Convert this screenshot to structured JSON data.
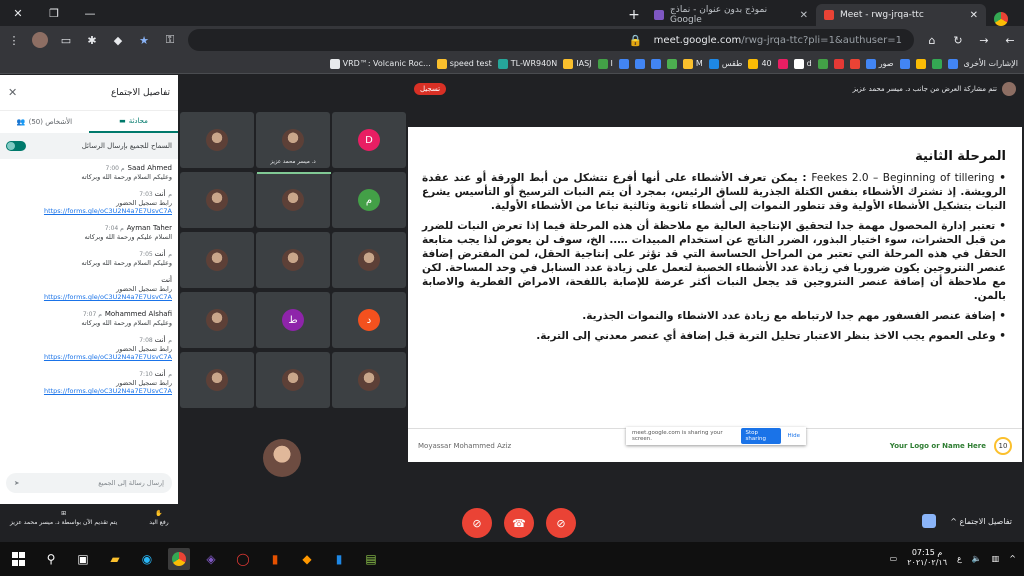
{
  "browser": {
    "tabs": [
      {
        "title": "Meet - rwg-jrqa-ttc",
        "color": "#ea4335",
        "active": true
      },
      {
        "title": "نموذج بدون عنوان - نماذج Google",
        "color": "#7e57c2",
        "active": false
      }
    ],
    "url_host": "meet.google.com",
    "url_path": "/rwg-jrqa-ttc?pli=1&authuser=1",
    "bookmarks": [
      {
        "label": "",
        "color": "#4285f4"
      },
      {
        "label": "",
        "color": "#34a853"
      },
      {
        "label": "",
        "color": "#fbbc05"
      },
      {
        "label": "",
        "color": "#4285f4"
      },
      {
        "label": "صور",
        "color": "#4285f4"
      },
      {
        "label": "",
        "color": "#ea4335"
      },
      {
        "label": "",
        "color": "#e53935"
      },
      {
        "label": "",
        "color": "#43a047"
      },
      {
        "label": "d",
        "color": "#ffffff"
      },
      {
        "label": "",
        "color": "#e91e63"
      },
      {
        "label": "40",
        "color": "#fbbc05"
      },
      {
        "label": "طقس",
        "color": "#1e88e5"
      },
      {
        "label": "M",
        "color": "#fbc02d"
      },
      {
        "label": "",
        "color": "#4caf50"
      },
      {
        "label": "",
        "color": "#4285f4"
      },
      {
        "label": "",
        "color": "#4285f4"
      },
      {
        "label": "",
        "color": "#4285f4"
      },
      {
        "label": "I",
        "color": "#43a047"
      },
      {
        "label": "IASJ",
        "color": "#fbc02d"
      },
      {
        "label": "TL-WR940N",
        "color": "#26a69a"
      },
      {
        "label": "speed test",
        "color": "#fbc02d"
      },
      {
        "label": "VRD™: Volcanic Roc...",
        "color": "#e8eaed"
      }
    ],
    "other_bookmarks": "الإشارات الأخرى"
  },
  "chat": {
    "title": "تفاصيل الاجتماع",
    "tab_chat": "محادثة",
    "tab_people": "الأشخاص (50)",
    "toggle_label": "السماح للجميع بإرسال الرسائل",
    "messages": [
      {
        "sender": "Saad Ahmed",
        "time": "7:00 م",
        "text": "وعليكم السلام ورحمة الله وبركاته",
        "link": ""
      },
      {
        "sender": "أنت",
        "time": "7:03 م",
        "text": "رابط تسجيل الحضور",
        "link": "https://forms.gle/oC3U2N4a7E7UsvC7A"
      },
      {
        "sender": "Ayman Taher",
        "time": "7:04 م",
        "text": "السلام عليكم ورحمة الله وبركاته",
        "link": ""
      },
      {
        "sender": "أنت",
        "time": "7:05 م",
        "text": "وعليكم السلام ورحمة الله وبركاته",
        "link": ""
      },
      {
        "sender": "أنت",
        "time": "",
        "text": "رابط تسجيل الحضور",
        "link": "https://forms.gle/oC3U2N4a7E7UsvC7A"
      },
      {
        "sender": "Mohammed Alshafi",
        "time": "7:07 م",
        "text": "وعليكم السلام ورحمة الله وبركاته",
        "link": ""
      },
      {
        "sender": "أنت",
        "time": "7:08 م",
        "text": "رابط تسجيل الحضور",
        "link": "https://forms.gle/oC3U2N4a7E7UsvC7A"
      },
      {
        "sender": "أنت",
        "time": "7:10 م",
        "text": "رابط تسجيل الحضور",
        "link": "https://forms.gle/oC3U2N4a7E7UsvC7A"
      }
    ],
    "input_placeholder": "إرسال رسالة إلى الجميع"
  },
  "grid": {
    "tiles": [
      {
        "name": "",
        "letter": "",
        "color": "",
        "photo": true
      },
      {
        "name": "د. ميسر محمد عزيز",
        "letter": "",
        "color": "",
        "photo": true
      },
      {
        "name": "",
        "letter": "D",
        "color": "#e91e63",
        "photo": false
      },
      {
        "name": "",
        "letter": "",
        "color": "",
        "photo": true
      },
      {
        "name": "",
        "letter": "",
        "color": "",
        "photo": true
      },
      {
        "name": "",
        "letter": "م",
        "color": "#43a047",
        "photo": false
      },
      {
        "name": "",
        "letter": "",
        "color": "",
        "photo": true
      },
      {
        "name": "",
        "letter": "",
        "color": "",
        "photo": true
      },
      {
        "name": "",
        "letter": "",
        "color": "",
        "photo": true
      },
      {
        "name": "",
        "letter": "",
        "color": "",
        "photo": true
      },
      {
        "name": "",
        "letter": "ط",
        "color": "#8e24aa",
        "photo": false
      },
      {
        "name": "",
        "letter": "د",
        "color": "#f4511e",
        "photo": false
      },
      {
        "name": "",
        "letter": "",
        "color": "",
        "photo": true
      },
      {
        "name": "",
        "letter": "",
        "color": "",
        "photo": true
      },
      {
        "name": "",
        "letter": "",
        "color": "",
        "photo": true
      }
    ]
  },
  "presentation": {
    "recording": "تسجيل",
    "presenter_text": "تتم مشاركة العرض من جانب د. ميسر محمد عزيز",
    "slide_title": "المرحلة الثانية",
    "p1_en": "Feekes 2.0 – Beginning of tillering",
    "p1": "يمكن تعرف الأشطاء على أنها أفرع تتشكل من أبط الورقة أو عند عقدة الرويشة. إذ تشترك الأشطاء بنفس الكتلة الجذرية للساق الرئيس، بمجرد أن يتم النبات الترسيخ أو التأسيس يشرع النبات بتشكيل الأشطاء الأولية وقد تتطور النموات إلى أشطاء ثانوية وثالثية تباعا من الأشطاء الأولية.",
    "p2": "تعتبر إدارة المحصول مهمة جدا لتحقيق الإنتاجية العالية مع ملاحظة أن هذه المرحلة فيما إذا تعرض النبات للضرر من قبل الحشرات، سوء اختيار البذور، الضرر الناتج عن استخدام المبيدات ….. الخ، سوف لن يعوض لذا يجب متابعة الحقل في هذه المرحلة التي تعتبر من المراحل الحساسة التي قد تؤثر على إنتاجية الحقل، لمن المفترض إضافة عنصر النتروجين يكون ضروريا في زيادة عدد الأشطاء الخصبة لتعمل على زيادة عدد السنابل في وحد المساحة. لكن مع ملاحظة أن إضافة عنصر النتروجين قد يجعل النبات أكثر عرضة للإصابة باللفحة، الامراض الفطرية والاصابة بالمن.",
    "p3": "إضافة عنصر الفسفور مهم جدا لارتباطه مع زيادة عدد الاشطاء والنموات الجذرية.",
    "p4": "وعلى العموم يجب الاخذ بنظر الاعتبار تحليل التربة قبل إضافة أي عنصر معدني إلى التربة.",
    "footer_author": "Moyassar Mohammed Aziz",
    "footer_logo": "Your Logo or Name Here",
    "slide_number": "10",
    "share_text": "meet.google.com is sharing your screen.",
    "stop_sharing": "Stop sharing",
    "hide": "Hide"
  },
  "controls": {
    "raise_hand": "رفع اليد",
    "present_now": "يتم تقديم الآن بواسطة د. ميسر محمد عزيز",
    "meeting_details": "تفاصيل الاجتماع"
  },
  "taskbar": {
    "time": "07:15 م",
    "date": "٢٠٢١/٠٢/١٦",
    "lang": "ع"
  }
}
